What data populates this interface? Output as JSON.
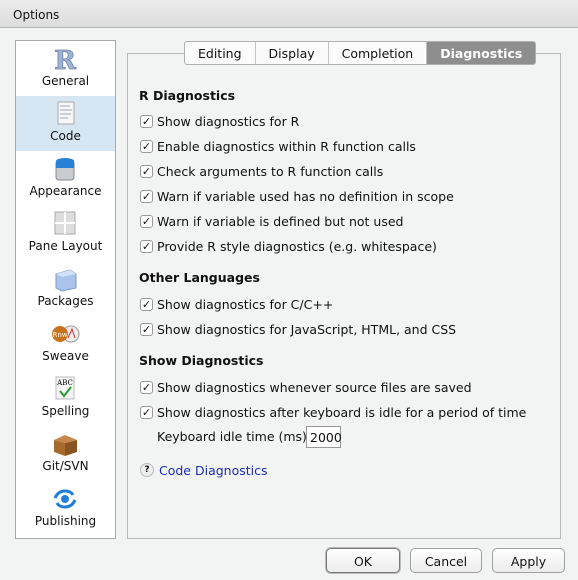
{
  "window": {
    "title": "Options"
  },
  "sidebar": {
    "items": [
      {
        "label": "General",
        "icon": "r-logo-icon",
        "selected": false
      },
      {
        "label": "Code",
        "icon": "code-document-icon",
        "selected": true
      },
      {
        "label": "Appearance",
        "icon": "paint-bucket-icon",
        "selected": false
      },
      {
        "label": "Pane Layout",
        "icon": "pane-layout-icon",
        "selected": false
      },
      {
        "label": "Packages",
        "icon": "package-cube-icon",
        "selected": false
      },
      {
        "label": "Sweave",
        "icon": "sweave-pdf-icon",
        "selected": false
      },
      {
        "label": "Spelling",
        "icon": "spelling-abc-icon",
        "selected": false
      },
      {
        "label": "Git/SVN",
        "icon": "cardboard-box-icon",
        "selected": false
      },
      {
        "label": "Publishing",
        "icon": "publishing-icon",
        "selected": false
      }
    ]
  },
  "tabs": [
    {
      "label": "Editing"
    },
    {
      "label": "Display"
    },
    {
      "label": "Completion"
    },
    {
      "label": "Diagnostics",
      "active": true
    }
  ],
  "sections": {
    "r": {
      "title": "R Diagnostics",
      "items": [
        {
          "label": "Show diagnostics for R",
          "checked": true
        },
        {
          "label": "Enable diagnostics within R function calls",
          "checked": true
        },
        {
          "label": "Check arguments to R function calls",
          "checked": true
        },
        {
          "label": "Warn if variable used has no definition in scope",
          "checked": true
        },
        {
          "label": "Warn if variable is defined but not used",
          "checked": true
        },
        {
          "label": "Provide R style diagnostics (e.g. whitespace)",
          "checked": true
        }
      ]
    },
    "other": {
      "title": "Other Languages",
      "items": [
        {
          "label": "Show diagnostics for C/C++",
          "checked": true
        },
        {
          "label": "Show diagnostics for JavaScript, HTML, and CSS",
          "checked": true
        }
      ]
    },
    "show": {
      "title": "Show Diagnostics",
      "items": [
        {
          "label": "Show diagnostics whenever source files are saved",
          "checked": true
        },
        {
          "label": "Show diagnostics after keyboard is idle for a period of time",
          "checked": true
        }
      ],
      "idle_label": "Keyboard idle time (ms):",
      "idle_value": "2000"
    }
  },
  "help": {
    "icon": "?",
    "link": "Code Diagnostics"
  },
  "buttons": {
    "ok": "OK",
    "cancel": "Cancel",
    "apply": "Apply"
  },
  "check_glyph": "✓",
  "colors": {
    "selected_bg": "#d7e6f3",
    "active_tab": "#8e8e8e",
    "link": "#1a2fb0"
  }
}
